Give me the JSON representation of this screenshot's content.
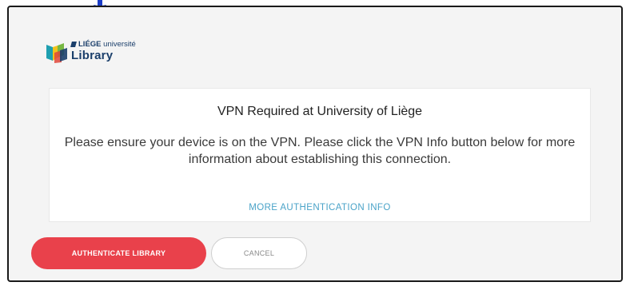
{
  "logo": {
    "brand_top": "LIÉGE",
    "brand_top_suffix": "université",
    "brand_bottom": "Library",
    "colors": {
      "blue": "#1b3f6b",
      "teal": "#1e9fb0",
      "yellow": "#f2c21b",
      "green": "#77b843",
      "red": "#e1473a"
    }
  },
  "dialog": {
    "title": "VPN Required at University of Liège",
    "message": "Please ensure your device is on the VPN. Please click the VPN Info button below for more information about establishing this connection.",
    "more_link": "MORE AUTHENTICATION INFO"
  },
  "buttons": {
    "authenticate_label": "AUTHENTICATE LIBRARY",
    "cancel_label": "CANCEL"
  },
  "colors": {
    "accent": "#e9414b",
    "link": "#4aa3c8",
    "cursor": "#1a3cc8"
  },
  "icons": {
    "cursor": "arrow-pointer-icon",
    "logo": "liege-logo-icon"
  }
}
